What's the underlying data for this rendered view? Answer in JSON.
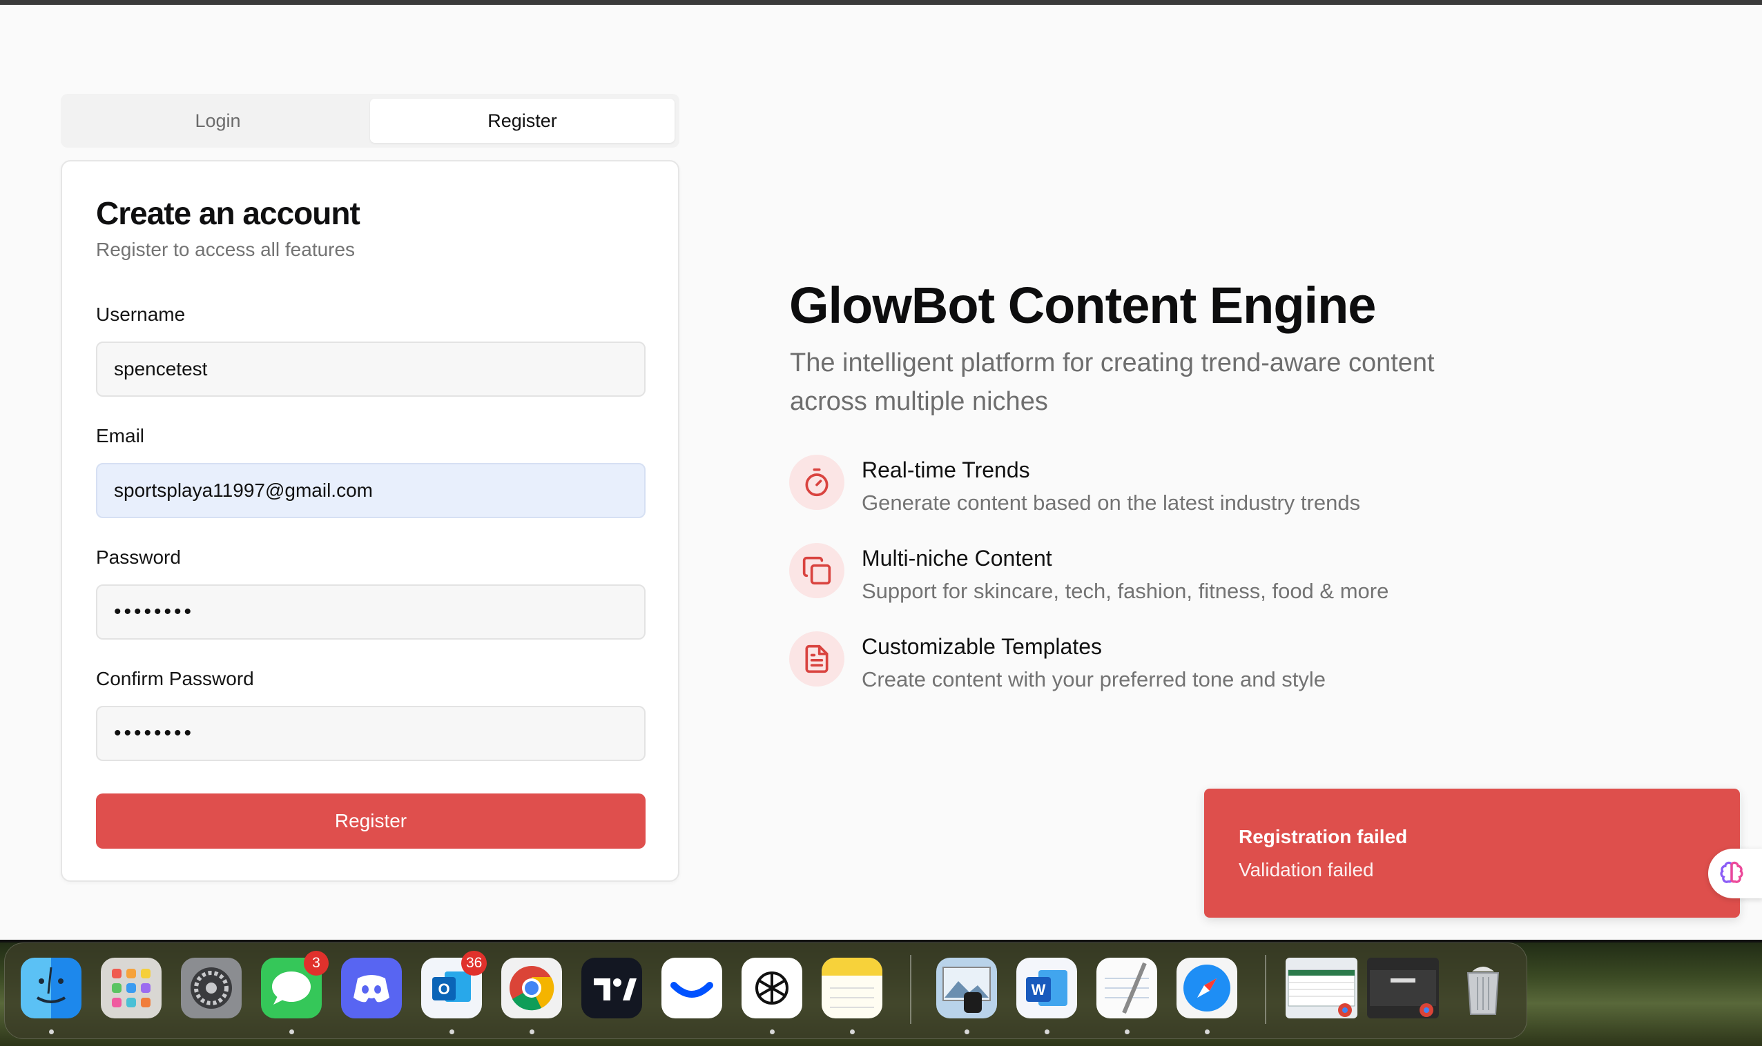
{
  "tabs": {
    "login": "Login",
    "register": "Register"
  },
  "form": {
    "title": "Create an account",
    "subtitle": "Register to access all features",
    "username_label": "Username",
    "username_value": "spencetest",
    "email_label": "Email",
    "email_value": "sportsplaya11997@gmail.com",
    "password_label": "Password",
    "password_value": "••••••••",
    "confirm_label": "Confirm Password",
    "confirm_value": "••••••••",
    "submit_label": "Register"
  },
  "hero": {
    "title": "GlowBot Content Engine",
    "subtitle": "The intelligent platform for creating trend-aware content across multiple niches",
    "features": [
      {
        "icon": "timer-icon",
        "title": "Real-time Trends",
        "desc": "Generate content based on the latest industry trends"
      },
      {
        "icon": "copy-icon",
        "title": "Multi-niche Content",
        "desc": "Support for skincare, tech, fashion, fitness, food & more"
      },
      {
        "icon": "document-icon",
        "title": "Customizable Templates",
        "desc": "Create content with your preferred tone and style"
      }
    ]
  },
  "toast": {
    "title": "Registration failed",
    "desc": "Validation failed"
  },
  "dock": {
    "badges": {
      "messages": "3",
      "outlook": "36"
    },
    "apps": [
      "finder",
      "launchpad",
      "system-settings",
      "messages",
      "discord",
      "outlook",
      "chrome",
      "tradingview",
      "coinbase-wallet",
      "chatgpt",
      "notes",
      "preview",
      "word",
      "textedit",
      "safari",
      "excel-window",
      "chrome-window",
      "trash"
    ]
  },
  "colors": {
    "accent": "#df4f4d",
    "icon_bg": "#fbe5e5",
    "icon_fg": "#d9433f"
  }
}
